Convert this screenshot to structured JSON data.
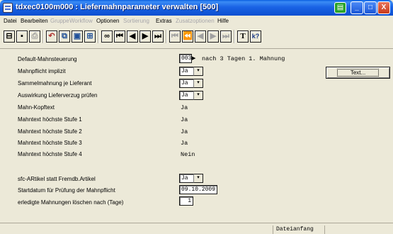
{
  "window": {
    "title": "tdxec0100m000 : Liefermahnparameter verwalten [500]",
    "accent_color": "#0b4fd0",
    "buttons": {
      "minimize": "_",
      "maximize": "□",
      "close": "X"
    }
  },
  "menu": {
    "items": [
      {
        "label": "Datei",
        "enabled": true
      },
      {
        "label": "Bearbeiten",
        "enabled": true
      },
      {
        "label": "Gruppe",
        "enabled": false
      },
      {
        "label": "Workflow",
        "enabled": false
      },
      {
        "label": "Optionen",
        "enabled": true
      },
      {
        "label": "Sortierung",
        "enabled": false
      },
      {
        "label": "Extras",
        "enabled": true
      },
      {
        "label": "Zusatzoptionen",
        "enabled": false
      },
      {
        "label": "Hilfe",
        "enabled": true
      }
    ]
  },
  "toolbar": {
    "icons": [
      "save-all-icon",
      "save-icon",
      "print-icon",
      "undo-icon",
      "copy-record-icon",
      "duplicate-icon",
      "find-icon",
      "binoculars-icon",
      "first-record-icon",
      "previous-record-icon",
      "next-record-icon",
      "last-record-icon",
      "first-group-icon",
      "prev-group-icon",
      "prev-page-icon",
      "next-page-icon",
      "last-group-icon",
      "text-icon",
      "help-icon"
    ],
    "text_label": "T",
    "help_label": "k?"
  },
  "form": {
    "default_mahnsteuerung": {
      "label": "Default-Mahnsteuerung",
      "value": "003",
      "description": "nach 3 Tagen 1. Mahnung"
    },
    "mahnpflicht_implizit": {
      "label": "Mahnpflicht implizit",
      "value": "Ja"
    },
    "sammelmahnung": {
      "label": "Sammelmahnung je Lieferant",
      "value": "Ja"
    },
    "auswirkung": {
      "label": "Auswirkung Lieferverzug prüfen",
      "value": "Ja"
    },
    "mahn_kopftext": {
      "label": "Mahn-Kopftext",
      "value": "Ja"
    },
    "stufe1": {
      "label": "Mahntext höchste Stufe 1",
      "value": "Ja"
    },
    "stufe2": {
      "label": "Mahntext höchste Stufe 2",
      "value": "Ja"
    },
    "stufe3": {
      "label": "Mahntext höchste Stufe 3",
      "value": "Ja"
    },
    "stufe4": {
      "label": "Mahntext höchste Stufe 4",
      "value": "Nein"
    },
    "sfc_artikel": {
      "label": "sfc-ARtikel statt Fremdb.Artikel",
      "value": "Ja"
    },
    "startdatum": {
      "label": "Startdatum für Prüfung der Mahnpflicht",
      "value": "09.10.2009"
    },
    "loeschen": {
      "label": "erledigte Mahnungen löschen nach (Tage)",
      "value": "1"
    },
    "text_button": "Text..."
  },
  "status": {
    "position": "Dateianfang"
  }
}
